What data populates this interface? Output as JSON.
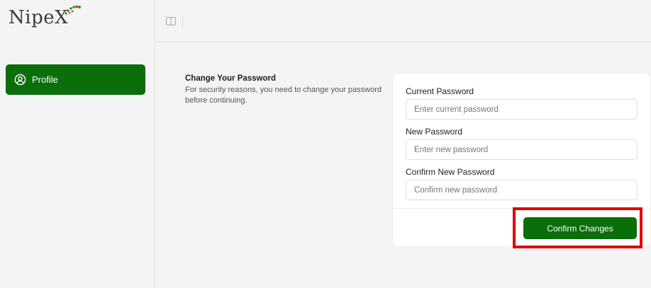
{
  "app": {
    "logo_text": "NipeX"
  },
  "sidebar": {
    "items": [
      {
        "label": "Profile",
        "icon": "user-circle-icon",
        "active": true
      }
    ]
  },
  "header": {
    "toggle_icon": "panel-toggle-icon"
  },
  "section": {
    "title": "Change Your Password",
    "description": "For security reasons, you need to change your password before continuing."
  },
  "form": {
    "current_password": {
      "label": "Current Password",
      "placeholder": "Enter current password",
      "value": ""
    },
    "new_password": {
      "label": "New Password",
      "placeholder": "Enter new password",
      "value": ""
    },
    "confirm_password": {
      "label": "Confirm New Password",
      "placeholder": "Confirm new password",
      "value": ""
    },
    "submit_label": "Confirm Changes"
  },
  "colors": {
    "brand_green": "#0a6e0a",
    "highlight_red": "#e00000"
  }
}
